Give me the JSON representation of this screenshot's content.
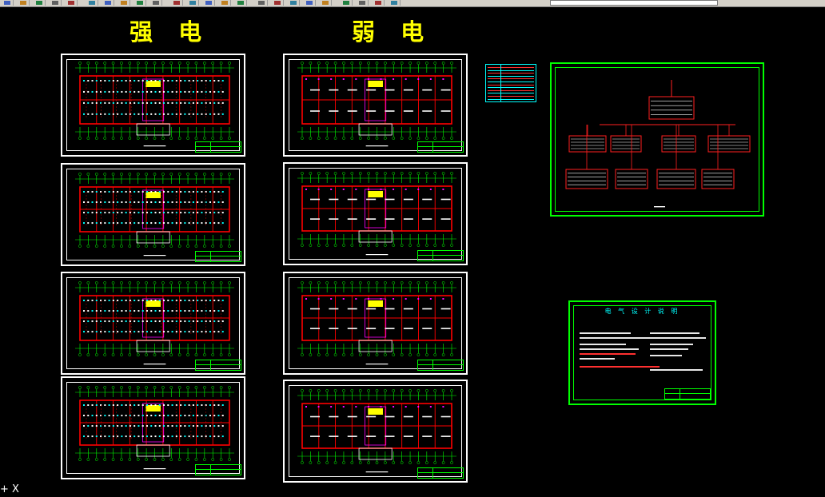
{
  "headings": {
    "strong_current": "强 电",
    "weak_current": "弱 电"
  },
  "notes_sheet": {
    "title": "电 气 设 计 说 明"
  },
  "cursor": {
    "glyph": "X"
  },
  "colors": {
    "background": "#000000",
    "heading": "#ffff00",
    "frame": "#ffffff",
    "wall": "#ff0000",
    "grid": "#00ff00",
    "accent": "#00ffff",
    "magenta": "#ff00ff"
  },
  "toolbar": {
    "icons": [
      "new-icon",
      "open-icon",
      "save-icon",
      "print-icon",
      "preview-icon",
      "cut-icon",
      "copy-icon",
      "paste-icon",
      "matchprop-icon",
      "undo-icon",
      "redo-icon",
      "pan-icon",
      "zoom-realtime-icon",
      "zoom-window-icon",
      "zoom-previous-icon",
      "properties-icon",
      "designcenter-icon",
      "toolpalette-icon",
      "calculator-icon",
      "help-icon",
      "layer-manager-icon",
      "layer-state-icon",
      "make-current-icon",
      "layer-previous-icon"
    ]
  }
}
